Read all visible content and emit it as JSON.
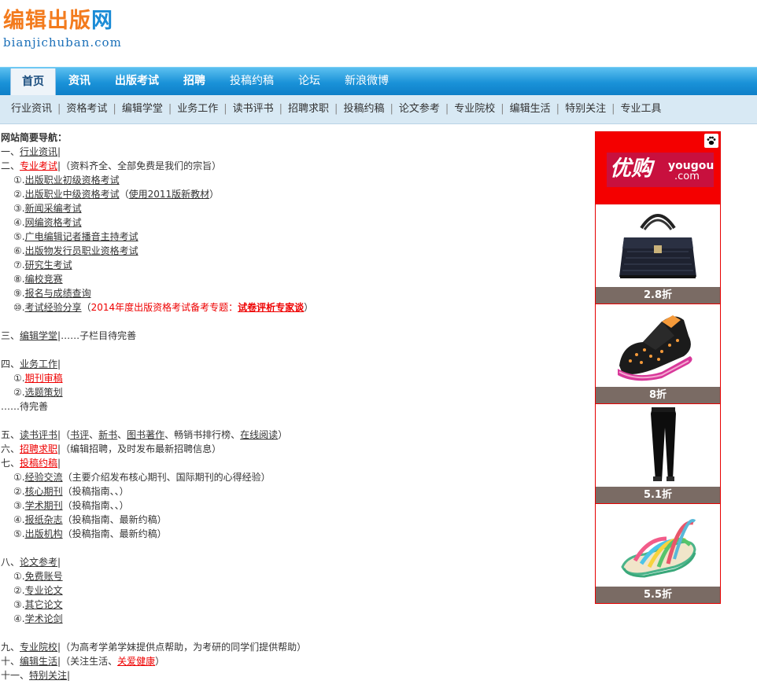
{
  "logo": {
    "main_orange": "编辑出版",
    "main_blue": "网",
    "sub": "bianjichuban.com"
  },
  "nav": {
    "items": [
      "首页",
      "资讯",
      "出版考试",
      "招聘",
      "投稿约稿",
      "论坛",
      "新浪微博"
    ]
  },
  "subnav": {
    "items": [
      "行业资讯",
      "资格考试",
      "编辑学堂",
      "业务工作",
      "读书评书",
      "招聘求职",
      "投稿约稿",
      "论文参考",
      "专业院校",
      "编辑生活",
      "特别关注",
      "专业工具"
    ],
    "separator": "|"
  },
  "content": {
    "heading": "网站简要导航：",
    "s1": {
      "prefix": "一、",
      "link": "行业资讯",
      "tail": "|"
    },
    "s2": {
      "prefix": "二、",
      "link": "专业考试",
      "tail": "|（资料齐全、全部免费是我们的宗旨）"
    },
    "s2_items": [
      {
        "num": "①.",
        "link": "出版职业初级资格考试"
      },
      {
        "num": "②.",
        "link": "出版职业中级资格考试",
        "pre": "（",
        "extra": "使用2011版新教材",
        "post": "）"
      },
      {
        "num": "③.",
        "link": "新闻采编考试"
      },
      {
        "num": "④.",
        "link": "网编资格考试"
      },
      {
        "num": "⑤.",
        "link": "广电编辑记者播音主持考试"
      },
      {
        "num": "⑥.",
        "link": "出版物发行员职业资格考试"
      },
      {
        "num": "⑦.",
        "link": "研究生考试"
      },
      {
        "num": "⑧.",
        "link": "编校竞赛"
      },
      {
        "num": "⑨.",
        "link": "报名与成绩查询"
      },
      {
        "num": "⑩.",
        "link": "考试经验分享",
        "pre": "（",
        "red_plain": "2014年度出版资格考试备考专题：",
        "red_link": "试卷评析专家谈",
        "post": "）"
      }
    ],
    "s3": {
      "prefix": "三、",
      "link": "编辑学堂",
      "tail": "|……子栏目待完善"
    },
    "s4": {
      "prefix": "四、",
      "link": "业务工作",
      "tail": "|"
    },
    "s4_items": [
      {
        "num": "①.",
        "link": "期刊审稿"
      },
      {
        "num": "②.",
        "link": "选题策划"
      }
    ],
    "s4_more": "……待完善",
    "s5": {
      "prefix": "五、",
      "link": "读书评书",
      "mid": "|（",
      "l1": "书评",
      "sep1": "、",
      "l2": "新书",
      "sep2": "、",
      "l3": "图书著作",
      "sep3": "、畅销书排行榜、",
      "l4": "在线阅读",
      "post": "）"
    },
    "s6": {
      "prefix": "六、",
      "link": "招聘求职",
      "tail": "|（编辑招聘，及时发布最新招聘信息）"
    },
    "s7": {
      "prefix": "七、",
      "link": "投稿约稿",
      "tail": "|"
    },
    "s7_items": [
      {
        "num": "①.",
        "link": "经验交流",
        "tail": "（主要介绍发布核心期刊、国际期刊的心得经验）"
      },
      {
        "num": "②.",
        "link": "核心期刊",
        "tail": "（投稿指南、、）"
      },
      {
        "num": "③.",
        "link": "学术期刊",
        "tail": "（投稿指南、、）"
      },
      {
        "num": "④.",
        "link": "报纸杂志",
        "tail": "（投稿指南、最新约稿）"
      },
      {
        "num": "⑤.",
        "link": "出版机构",
        "tail": "（投稿指南、最新约稿）"
      }
    ],
    "s8": {
      "prefix": "八、",
      "link": "论文参考",
      "tail": "|"
    },
    "s8_items": [
      {
        "num": "①.",
        "link": "免费账号"
      },
      {
        "num": "②.",
        "link": "专业论文"
      },
      {
        "num": "③.",
        "link": "其它论文"
      },
      {
        "num": "④.",
        "link": "学术论剑"
      }
    ],
    "s9": {
      "prefix": "九、",
      "link": "专业院校",
      "tail": "|（为高考学弟学妹提供点帮助，为考研的同学们提供帮助）"
    },
    "s10": {
      "prefix": "十、",
      "link": "编辑生活",
      "mid": "|（关注生活、",
      "red_link": "关爱健康",
      "post": "）"
    },
    "s11": {
      "prefix": "十一、",
      "link": "特别关注",
      "tail": "|"
    }
  },
  "ad": {
    "logo_cn": "优购",
    "logo_en": "yougou",
    "logo_dom": ".com",
    "paw_icon": "paw-icon",
    "products": [
      {
        "name": "handbag",
        "discount": "2.8折"
      },
      {
        "name": "sneaker",
        "discount": "8折"
      },
      {
        "name": "pants",
        "discount": "5.1折"
      },
      {
        "name": "sandal",
        "discount": "5.5折"
      }
    ]
  }
}
